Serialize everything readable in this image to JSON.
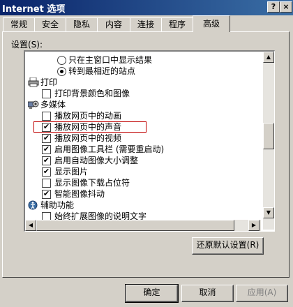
{
  "window": {
    "title": "Internet 选项",
    "help_button": "?",
    "close_button": "×"
  },
  "tabs": [
    {
      "label": "常规"
    },
    {
      "label": "安全"
    },
    {
      "label": "隐私"
    },
    {
      "label": "内容"
    },
    {
      "label": "连接"
    },
    {
      "label": "程序"
    },
    {
      "label": "高级"
    }
  ],
  "active_tab": "高级",
  "settings_label": "设置(S):",
  "list_items": [
    {
      "type": "radio",
      "label": "只在主窗口中显示结果",
      "checked": false
    },
    {
      "type": "radio",
      "label": "转到最相近的站点",
      "checked": true
    },
    {
      "type": "category",
      "label": "打印",
      "icon": "printer-icon"
    },
    {
      "type": "checkbox",
      "label": "打印背景颜色和图像",
      "checked": false
    },
    {
      "type": "category",
      "label": "多媒体",
      "icon": "multimedia-icon"
    },
    {
      "type": "checkbox",
      "label": "播放网页中的动画",
      "checked": false
    },
    {
      "type": "checkbox",
      "label": "播放网页中的声音",
      "checked": true
    },
    {
      "type": "checkbox",
      "label": "播放网页中的视频",
      "checked": true
    },
    {
      "type": "checkbox",
      "label": "启用图像工具栏 (需要重启动)",
      "checked": true
    },
    {
      "type": "checkbox",
      "label": "启用自动图像大小调整",
      "checked": true
    },
    {
      "type": "checkbox",
      "label": "显示图片",
      "checked": true
    },
    {
      "type": "checkbox",
      "label": "显示图像下载占位符",
      "checked": false
    },
    {
      "type": "checkbox",
      "label": "智能图像抖动",
      "checked": true
    },
    {
      "type": "category",
      "label": "辅助功能",
      "icon": "accessibility-icon"
    },
    {
      "type": "checkbox",
      "label": "始终扩展图像的说明文字",
      "checked": false
    }
  ],
  "restore_button": "还原默认设置(R)",
  "ok_button": "确定",
  "cancel_button": "取消",
  "apply_button": "应用(A)"
}
